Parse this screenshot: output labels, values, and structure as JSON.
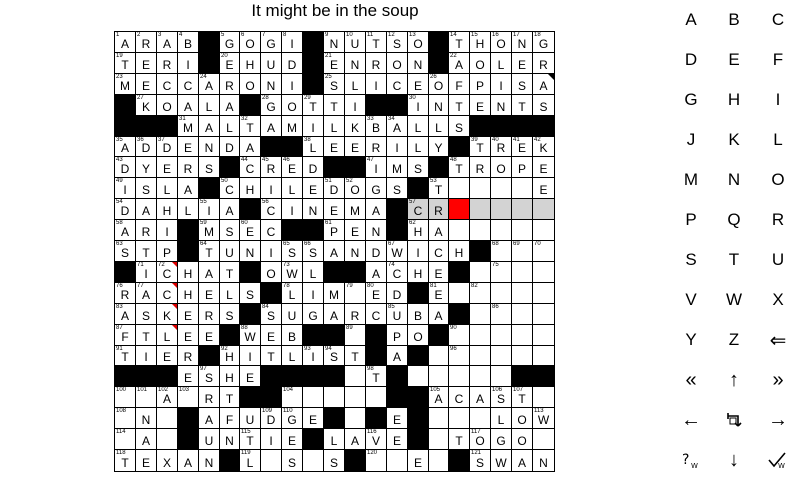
{
  "title": "It might be in the soup",
  "grid": {
    "rows": [
      "ARAB#GOGI#NUTSO#THONG",
      "TERI#EHUD#ENRON#AOLER",
      "MECCARONI#SLICEOFPISA",
      "#KOALA#GOTTI##INTENTS",
      "###MALTAMILKBALLS####",
      "ADDENDA##LEERILY#TREK",
      "DYERS#CRED##IMS#TROPE",
      "ISLA#CHILEDOGS#T....E",
      "DAHLIA#CINEMA#CR.....",
      "ARI#MSEC##PEN#HA.....",
      "STP#TUNISSANDWICH#...",
      "#ICHAT#OWL##ACHE#....",
      "RACHELS#LIM.ED#E.....",
      "ASKERS#SUGARCUBA#....",
      "FTLEE#WEB##.#PO#.....",
      "TIER#HITLIST#A#......",
      "###ESHE####.T#.....##",
      "..A.RT##.....##ACAST.",
      ".N.#AFUDGE#.#E#...LOW",
      ".A.#UNTIE#LAVE#.TOGO.",
      "TEXAN#L.S.S#..E.#SWAN"
    ],
    "numbers": [
      {
        "r": 0,
        "c": 0,
        "n": 1
      },
      {
        "r": 0,
        "c": 1,
        "n": 2
      },
      {
        "r": 0,
        "c": 2,
        "n": 3
      },
      {
        "r": 0,
        "c": 3,
        "n": 4
      },
      {
        "r": 0,
        "c": 5,
        "n": 5
      },
      {
        "r": 0,
        "c": 6,
        "n": 6
      },
      {
        "r": 0,
        "c": 7,
        "n": 7
      },
      {
        "r": 0,
        "c": 8,
        "n": 8
      },
      {
        "r": 0,
        "c": 10,
        "n": 9
      },
      {
        "r": 0,
        "c": 11,
        "n": 10
      },
      {
        "r": 0,
        "c": 12,
        "n": 11
      },
      {
        "r": 0,
        "c": 13,
        "n": 12
      },
      {
        "r": 0,
        "c": 14,
        "n": 13
      },
      {
        "r": 0,
        "c": 16,
        "n": 14
      },
      {
        "r": 0,
        "c": 17,
        "n": 15
      },
      {
        "r": 0,
        "c": 18,
        "n": 16
      },
      {
        "r": 0,
        "c": 19,
        "n": 17
      },
      {
        "r": 0,
        "c": 20,
        "n": 18
      },
      {
        "r": 1,
        "c": 0,
        "n": 19
      },
      {
        "r": 1,
        "c": 5,
        "n": 20
      },
      {
        "r": 1,
        "c": 10,
        "n": 21
      },
      {
        "r": 1,
        "c": 16,
        "n": 22
      },
      {
        "r": 2,
        "c": 0,
        "n": 23
      },
      {
        "r": 2,
        "c": 4,
        "n": 24
      },
      {
        "r": 2,
        "c": 10,
        "n": 25
      },
      {
        "r": 2,
        "c": 15,
        "n": 26
      },
      {
        "r": 3,
        "c": 1,
        "n": 27
      },
      {
        "r": 3,
        "c": 7,
        "n": 28
      },
      {
        "r": 3,
        "c": 9,
        "n": 29
      },
      {
        "r": 3,
        "c": 14,
        "n": 30
      },
      {
        "r": 4,
        "c": 3,
        "n": 31
      },
      {
        "r": 4,
        "c": 6,
        "n": 32
      },
      {
        "r": 4,
        "c": 12,
        "n": 33
      },
      {
        "r": 4,
        "c": 13,
        "n": 34
      },
      {
        "r": 5,
        "c": 0,
        "n": 35
      },
      {
        "r": 5,
        "c": 1,
        "n": 36
      },
      {
        "r": 5,
        "c": 2,
        "n": 37
      },
      {
        "r": 5,
        "c": 9,
        "n": 38
      },
      {
        "r": 5,
        "c": 17,
        "n": 39
      },
      {
        "r": 5,
        "c": 18,
        "n": 40
      },
      {
        "r": 5,
        "c": 19,
        "n": 41
      },
      {
        "r": 5,
        "c": 20,
        "n": 42
      },
      {
        "r": 6,
        "c": 0,
        "n": 43
      },
      {
        "r": 6,
        "c": 6,
        "n": 44
      },
      {
        "r": 6,
        "c": 7,
        "n": 45
      },
      {
        "r": 6,
        "c": 8,
        "n": 46
      },
      {
        "r": 6,
        "c": 12,
        "n": 47
      },
      {
        "r": 6,
        "c": 16,
        "n": 48
      },
      {
        "r": 7,
        "c": 0,
        "n": 49
      },
      {
        "r": 7,
        "c": 5,
        "n": 50
      },
      {
        "r": 7,
        "c": 10,
        "n": 51
      },
      {
        "r": 7,
        "c": 11,
        "n": 52
      },
      {
        "r": 7,
        "c": 15,
        "n": 53
      },
      {
        "r": 8,
        "c": 0,
        "n": 54
      },
      {
        "r": 8,
        "c": 4,
        "n": 55
      },
      {
        "r": 8,
        "c": 7,
        "n": 56
      },
      {
        "r": 8,
        "c": 14,
        "n": 57
      },
      {
        "r": 9,
        "c": 0,
        "n": 58
      },
      {
        "r": 9,
        "c": 4,
        "n": 59
      },
      {
        "r": 9,
        "c": 6,
        "n": 60
      },
      {
        "r": 9,
        "c": 10,
        "n": 61
      },
      {
        "r": 9,
        "c": 14,
        "n": 62
      },
      {
        "r": 10,
        "c": 0,
        "n": 63
      },
      {
        "r": 10,
        "c": 4,
        "n": 64
      },
      {
        "r": 10,
        "c": 8,
        "n": 65
      },
      {
        "r": 10,
        "c": 9,
        "n": 66
      },
      {
        "r": 10,
        "c": 13,
        "n": 67
      },
      {
        "r": 10,
        "c": 18,
        "n": 68
      },
      {
        "r": 10,
        "c": 19,
        "n": 69
      },
      {
        "r": 10,
        "c": 20,
        "n": 70
      },
      {
        "r": 11,
        "c": 1,
        "n": 71
      },
      {
        "r": 11,
        "c": 2,
        "n": 72
      },
      {
        "r": 11,
        "c": 8,
        "n": 73
      },
      {
        "r": 11,
        "c": 13,
        "n": 74
      },
      {
        "r": 11,
        "c": 18,
        "n": 75
      },
      {
        "r": 12,
        "c": 0,
        "n": 76
      },
      {
        "r": 12,
        "c": 1,
        "n": 77
      },
      {
        "r": 12,
        "c": 8,
        "n": 78
      },
      {
        "r": 12,
        "c": 11,
        "n": 79
      },
      {
        "r": 12,
        "c": 12,
        "n": 80
      },
      {
        "r": 12,
        "c": 15,
        "n": 81
      },
      {
        "r": 12,
        "c": 17,
        "n": 82
      },
      {
        "r": 13,
        "c": 0,
        "n": 83
      },
      {
        "r": 13,
        "c": 7,
        "n": 84
      },
      {
        "r": 13,
        "c": 13,
        "n": 85
      },
      {
        "r": 13,
        "c": 18,
        "n": 86
      },
      {
        "r": 14,
        "c": 0,
        "n": 87
      },
      {
        "r": 14,
        "c": 6,
        "n": 88
      },
      {
        "r": 14,
        "c": 11,
        "n": 89
      },
      {
        "r": 14,
        "c": 16,
        "n": 90
      },
      {
        "r": 15,
        "c": 0,
        "n": 91
      },
      {
        "r": 15,
        "c": 5,
        "n": 92
      },
      {
        "r": 15,
        "c": 9,
        "n": 93
      },
      {
        "r": 15,
        "c": 10,
        "n": 94
      },
      {
        "r": 15,
        "c": 14,
        "n": 95
      },
      {
        "r": 15,
        "c": 16,
        "n": 96
      },
      {
        "r": 16,
        "c": 4,
        "n": 97
      },
      {
        "r": 16,
        "c": 12,
        "n": 98
      },
      {
        "r": 16,
        "c": 13,
        "n": 99
      },
      {
        "r": 17,
        "c": 0,
        "n": 100
      },
      {
        "r": 17,
        "c": 1,
        "n": 101
      },
      {
        "r": 17,
        "c": 2,
        "n": 102
      },
      {
        "r": 17,
        "c": 3,
        "n": 103
      },
      {
        "r": 17,
        "c": 8,
        "n": 104
      },
      {
        "r": 17,
        "c": 15,
        "n": 105
      },
      {
        "r": 17,
        "c": 18,
        "n": 106
      },
      {
        "r": 17,
        "c": 19,
        "n": 107
      },
      {
        "r": 18,
        "c": 0,
        "n": 108
      },
      {
        "r": 18,
        "c": 7,
        "n": 109
      },
      {
        "r": 18,
        "c": 8,
        "n": 110
      },
      {
        "r": 18,
        "c": 12,
        "n": 111
      },
      {
        "r": 18,
        "c": 14,
        "n": 112
      },
      {
        "r": 18,
        "c": 20,
        "n": 113
      },
      {
        "r": 19,
        "c": 0,
        "n": 114
      },
      {
        "r": 19,
        "c": 6,
        "n": 115
      },
      {
        "r": 19,
        "c": 12,
        "n": 116
      },
      {
        "r": 19,
        "c": 17,
        "n": 117
      },
      {
        "r": 20,
        "c": 0,
        "n": 118
      },
      {
        "r": 20,
        "c": 6,
        "n": 119
      },
      {
        "r": 20,
        "c": 12,
        "n": 120
      },
      {
        "r": 20,
        "c": 17,
        "n": 121
      }
    ],
    "highlight_cells": [
      [
        8,
        14
      ],
      [
        8,
        15
      ],
      [
        8,
        17
      ],
      [
        8,
        18
      ],
      [
        8,
        19
      ],
      [
        8,
        20
      ]
    ],
    "cursor_cell": [
      8,
      16
    ],
    "red_marks": [
      [
        11,
        2
      ],
      [
        12,
        2
      ],
      [
        13,
        2
      ],
      [
        14,
        2
      ]
    ],
    "black_corner_marks": [
      [
        2,
        20
      ],
      [
        10,
        3
      ]
    ]
  },
  "keyboard": {
    "letters": [
      "A",
      "B",
      "C",
      "D",
      "E",
      "F",
      "G",
      "H",
      "I",
      "J",
      "K",
      "L",
      "M",
      "N",
      "O",
      "P",
      "Q",
      "R",
      "S",
      "T",
      "U",
      "V",
      "W",
      "X",
      "Y",
      "Z"
    ],
    "controls": [
      {
        "name": "backspace-icon",
        "glyph": "⇐"
      },
      {
        "name": "double-left-icon",
        "glyph": "«"
      },
      {
        "name": "up-arrow-icon",
        "glyph": "↑"
      },
      {
        "name": "double-right-icon",
        "glyph": "»"
      },
      {
        "name": "left-arrow-icon",
        "glyph": "←"
      },
      {
        "name": "toggle-direction-icon",
        "glyph": ""
      },
      {
        "name": "right-arrow-icon",
        "glyph": "→"
      },
      {
        "name": "hint-icon",
        "glyph": ""
      },
      {
        "name": "down-arrow-icon",
        "glyph": "↓"
      },
      {
        "name": "check-icon",
        "glyph": ""
      }
    ]
  },
  "colors": {
    "cursor": "#ff0000",
    "highlight": "#d3d3d3",
    "block": "#000000",
    "mark": "#dd0000"
  }
}
